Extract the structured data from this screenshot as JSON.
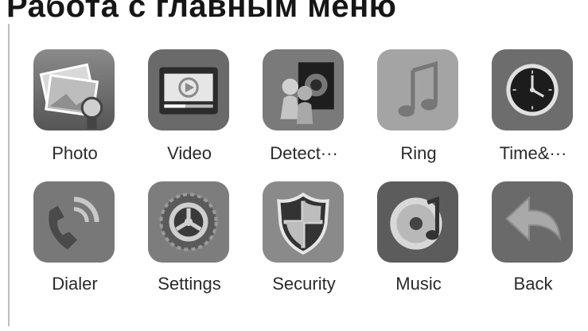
{
  "page": {
    "title": "Работа с главным меню"
  },
  "menu": {
    "items": [
      {
        "label": "Photo",
        "icon": "photo-icon"
      },
      {
        "label": "Video",
        "icon": "video-icon"
      },
      {
        "label": "Detect···",
        "icon": "detect-icon"
      },
      {
        "label": "Ring",
        "icon": "ring-icon"
      },
      {
        "label": "Time&···",
        "icon": "clock-icon"
      },
      {
        "label": "Dialer",
        "icon": "dialer-icon"
      },
      {
        "label": "Settings",
        "icon": "settings-icon"
      },
      {
        "label": "Security",
        "icon": "security-icon"
      },
      {
        "label": "Music",
        "icon": "music-icon"
      },
      {
        "label": "Back",
        "icon": "back-icon"
      }
    ]
  }
}
